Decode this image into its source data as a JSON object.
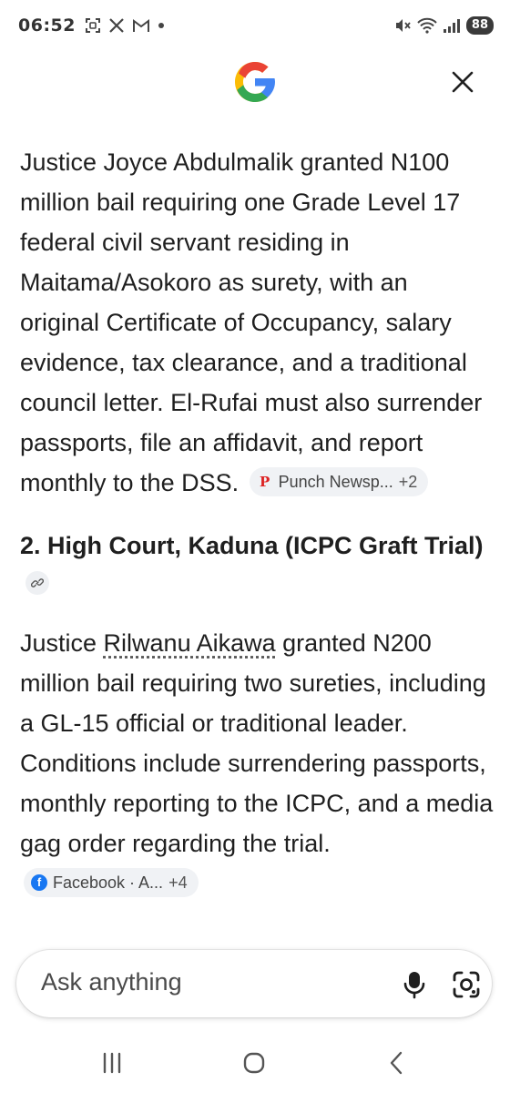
{
  "status_bar": {
    "time": "06:52",
    "battery": "88",
    "icons": [
      "screenshot-icon",
      "x-icon",
      "gmail-icon",
      "dot-icon",
      "mute-icon",
      "wifi-icon",
      "signal-icon"
    ]
  },
  "header": {
    "logo": "google-g-icon",
    "close_icon": "close-icon"
  },
  "content": {
    "paragraph_1": "Justice Joyce Abdulmalik granted N100 million bail requiring one Grade Level 17 federal civil servant residing in Maitama/Asokoro as surety, with an original Certificate of Occupancy, salary evidence, tax clearance, and a traditional council letter. El-Rufai must also surrender passports, file an affidavit, and report monthly to the DSS.",
    "source_chip_1": {
      "label": "Punch Newsp...",
      "more": "+2"
    },
    "heading_2": "2. High Court, Kaduna (ICPC Graft Trial)",
    "paragraph_2_prefix": "Justice ",
    "paragraph_2_name": "Rilwanu Aikawa",
    "paragraph_2_rest": " granted N200 million bail requiring two sureties, including a GL-15 official or traditional leader. Conditions include surrendering passports, monthly reporting to the ICPC, and a media gag order regarding the trial.",
    "source_chip_2": {
      "label": "Facebook · A...",
      "more": "+4"
    }
  },
  "input": {
    "placeholder": "Ask anything"
  },
  "colors": {
    "google_blue": "#4285F4",
    "google_red": "#EA4335",
    "google_yellow": "#FBBC05",
    "google_green": "#34A853",
    "facebook_blue": "#1877F2"
  }
}
